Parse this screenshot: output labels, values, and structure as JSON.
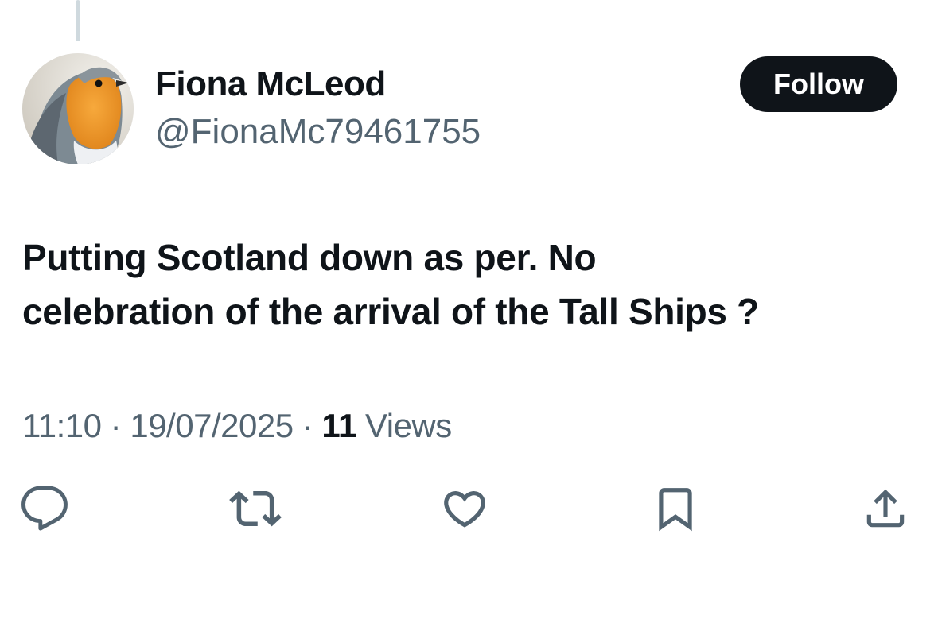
{
  "author": {
    "display_name": "Fiona McLeod",
    "handle": "@FionaMc79461755",
    "avatar_icon": "robin-avatar"
  },
  "follow_button": {
    "label": "Follow"
  },
  "tweet": {
    "text_line1": "Putting Scotland down as per. No",
    "text_line2": "celebration of the arrival of the Tall Ships ?",
    "time": "11:10",
    "date": "19/07/2025",
    "separator": "·",
    "views_count": "11",
    "views_label": "Views"
  },
  "actions": [
    {
      "icon": "reply-icon"
    },
    {
      "icon": "retweet-icon"
    },
    {
      "icon": "like-icon"
    },
    {
      "icon": "bookmark-icon"
    },
    {
      "icon": "share-icon"
    }
  ],
  "colors": {
    "primary_text": "#0f1419",
    "secondary_text": "#536471",
    "button_bg": "#0f1419",
    "thread_line": "#cfd9de"
  }
}
